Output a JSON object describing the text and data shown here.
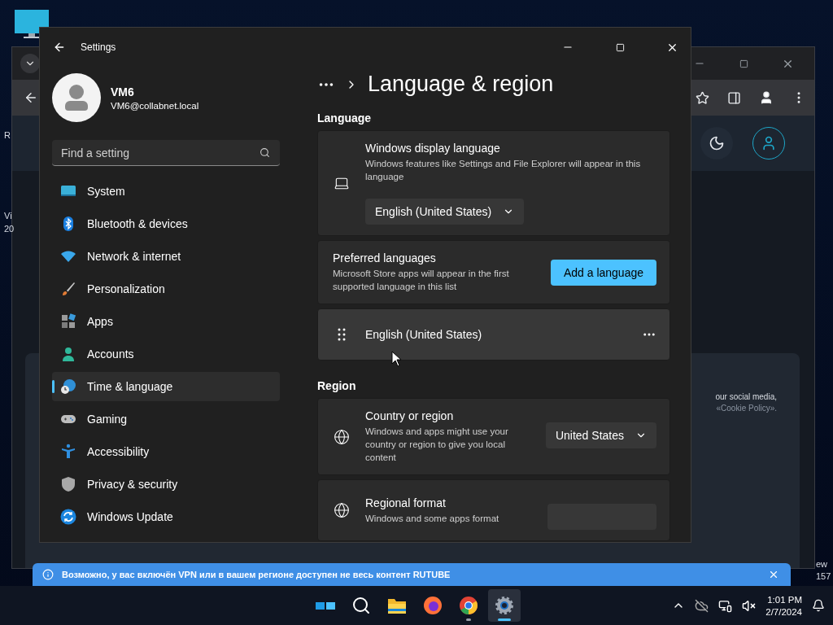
{
  "desktop": {
    "left_texts": [
      "R",
      "Vi",
      "20"
    ],
    "right_texts": [
      "ew",
      "157"
    ]
  },
  "browser": {
    "cookie_lines": [
      {
        "kind": "text",
        "text": "our social media,"
      },
      {
        "kind": "link",
        "text": "«Cookie Policy»."
      }
    ]
  },
  "settings": {
    "title": "Settings",
    "user": {
      "name": "VM6",
      "email": "VM6@collabnet.local"
    },
    "search": {
      "placeholder": "Find a setting"
    },
    "nav": [
      {
        "kind": "system",
        "label": "System",
        "selected": false
      },
      {
        "kind": "bluetooth",
        "label": "Bluetooth & devices",
        "selected": false
      },
      {
        "kind": "network",
        "label": "Network & internet",
        "selected": false
      },
      {
        "kind": "personalization",
        "label": "Personalization",
        "selected": false
      },
      {
        "kind": "apps",
        "label": "Apps",
        "selected": false
      },
      {
        "kind": "accounts",
        "label": "Accounts",
        "selected": false
      },
      {
        "kind": "time",
        "label": "Time & language",
        "selected": true
      },
      {
        "kind": "gaming",
        "label": "Gaming",
        "selected": false
      },
      {
        "kind": "accessibility",
        "label": "Accessibility",
        "selected": false
      },
      {
        "kind": "privacy",
        "label": "Privacy & security",
        "selected": false
      },
      {
        "kind": "update",
        "label": "Windows Update",
        "selected": false
      }
    ],
    "page_title": "Language & region",
    "sections": [
      {
        "heading": "Language",
        "cards": [
          {
            "kind": "dropdown",
            "title": "Windows display language",
            "description": "Windows features like Settings and File Explorer will appear in this language",
            "value": "English (United States)"
          },
          {
            "kind": "button",
            "title": "Preferred languages",
            "description": "Microsoft Store apps will appear in the first supported language in this list",
            "button": "Add a language"
          },
          {
            "kind": "language",
            "title": "English (United States)",
            "hovered": true
          }
        ]
      },
      {
        "heading": "Region",
        "cards": [
          {
            "kind": "side-dropdown",
            "title": "Country or region",
            "description": "Windows and apps might use your country or region to give you local content",
            "value": "United States"
          },
          {
            "kind": "side-dropdown",
            "title": "Regional format",
            "description": "Windows and some apps format"
          }
        ]
      }
    ]
  },
  "notification": {
    "text": "Возможно, у вас включён VPN или в вашем регионе доступен не весь контент RUTUBE"
  },
  "taskbar": {
    "apps": [
      {
        "kind": "start",
        "running": false,
        "selected": false
      },
      {
        "kind": "search",
        "running": false,
        "selected": false
      },
      {
        "kind": "explorer",
        "running": false,
        "selected": false
      },
      {
        "kind": "firefox",
        "running": false,
        "selected": false
      },
      {
        "kind": "chrome",
        "running": true,
        "selected": false
      },
      {
        "kind": "settings",
        "running": true,
        "selected": true
      }
    ],
    "time": "1:01 PM",
    "date": "2/7/2024"
  }
}
